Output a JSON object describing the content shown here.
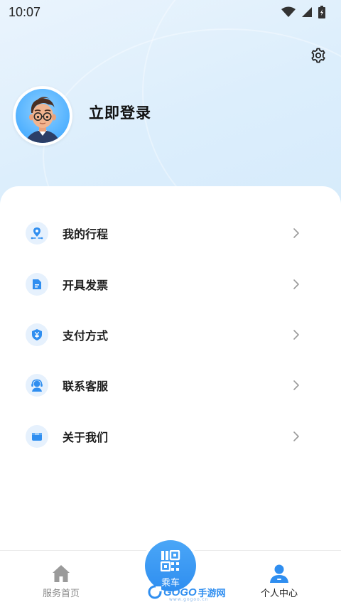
{
  "status_bar": {
    "time": "10:07",
    "icons": [
      "wifi-icon",
      "signal-icon",
      "battery-icon"
    ]
  },
  "header": {
    "settings_icon": "gear-icon",
    "login_label": "立即登录"
  },
  "menu": {
    "items": [
      {
        "label": "我的行程",
        "icon": "location-pin-icon"
      },
      {
        "label": "开具发票",
        "icon": "invoice-icon"
      },
      {
        "label": "支付方式",
        "icon": "yen-shield-icon"
      },
      {
        "label": "联系客服",
        "icon": "headset-icon"
      },
      {
        "label": "关于我们",
        "icon": "box-icon"
      }
    ]
  },
  "tabbar": {
    "tabs": [
      {
        "label": "服务首页",
        "icon": "home-icon",
        "active": false
      },
      {
        "label": "乘车",
        "icon": "qr-code-icon",
        "active": false
      },
      {
        "label": "个人中心",
        "icon": "user-icon",
        "active": true
      }
    ]
  },
  "watermark": {
    "brand": "GOGO",
    "suffix": "手游网",
    "url": "www.gogoo.cn"
  },
  "colors": {
    "accent": "#2f8ef0",
    "icon_bg": "#e6f1fd",
    "header_bg": "#dceefc",
    "tab_inactive": "#8a8a8a",
    "tab_active": "#1a1a1a"
  }
}
